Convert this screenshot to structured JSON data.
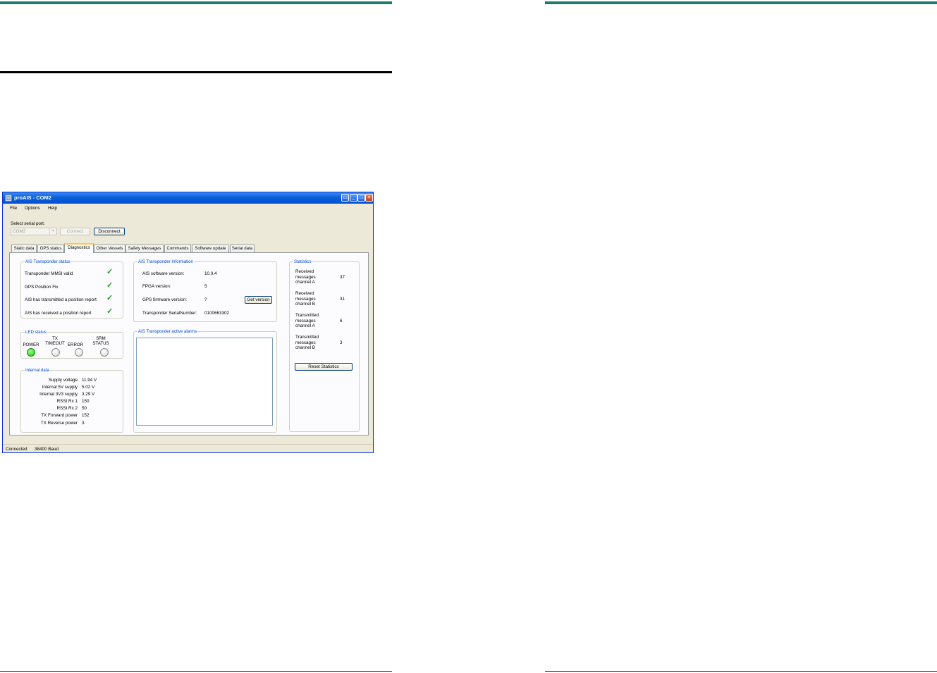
{
  "window": {
    "title": "proAIS - COM2",
    "icon_text": "pro AIS"
  },
  "menu": [
    "File",
    "Options",
    "Help"
  ],
  "serial": {
    "label": "Select serial port:",
    "port": "COM2",
    "connect": "Connect",
    "disconnect": "Disconnect"
  },
  "tabs": [
    "Static data",
    "GPS status",
    "Diagnostics",
    "Other Vessels",
    "Safety Messages",
    "Commands",
    "Software update",
    "Serial data"
  ],
  "transponder_status": {
    "title": "AIS Transponder status",
    "items": [
      "Transponder MMSI valid",
      "GPS Position Fix",
      "AIS has transmitted a position report",
      "AIS has received a position report"
    ]
  },
  "led_status": {
    "title": "LED status",
    "leds": [
      {
        "label": "POWER",
        "on": true
      },
      {
        "label": "TX TIMEOUT",
        "on": false
      },
      {
        "label": "ERROR",
        "on": false
      },
      {
        "label": "SRM STATUS",
        "on": false
      }
    ]
  },
  "internal_data": {
    "title": "Internal data",
    "rows": [
      {
        "label": "Supply voltage",
        "value": "11.94 V"
      },
      {
        "label": "Internal 5V supply",
        "value": "5.02 V"
      },
      {
        "label": "Internal 3V3 supply",
        "value": "3.29 V"
      },
      {
        "label": "RSSI Rx 1",
        "value": "150"
      },
      {
        "label": "RSSI Rx 2",
        "value": "50"
      },
      {
        "label": "TX Forward power",
        "value": "152"
      },
      {
        "label": "TX Reverse power",
        "value": "3"
      }
    ]
  },
  "transponder_info": {
    "title": "AIS Transponder Information",
    "software_label": "AIS software version:",
    "software_value": "10.0.4",
    "fpga_label": "FPGA version:",
    "fpga_value": "5",
    "gps_label": "GPS firmware version:",
    "gps_value": "?",
    "get_version": "Get version",
    "serial_label": "Transponder SerialNumber:",
    "serial_value": "0100663302"
  },
  "alarms": {
    "title": "AIS Transponder active alarms"
  },
  "statistics": {
    "title": "Statistics",
    "rows": [
      {
        "line1": "Received",
        "line2": "messages",
        "line3": "channel A",
        "value": "37"
      },
      {
        "line1": "Received",
        "line2": "messages",
        "line3": "channel B",
        "value": "31"
      },
      {
        "line1": "Transmitted",
        "line2": "messages",
        "line3": "channel A",
        "value": "6"
      },
      {
        "line1": "Transmitted",
        "line2": "messages",
        "line3": "channel B",
        "value": "3"
      }
    ],
    "reset": "Reset Statistics"
  },
  "status_bar": {
    "state": "Connected",
    "baud": "38400 Baud"
  }
}
